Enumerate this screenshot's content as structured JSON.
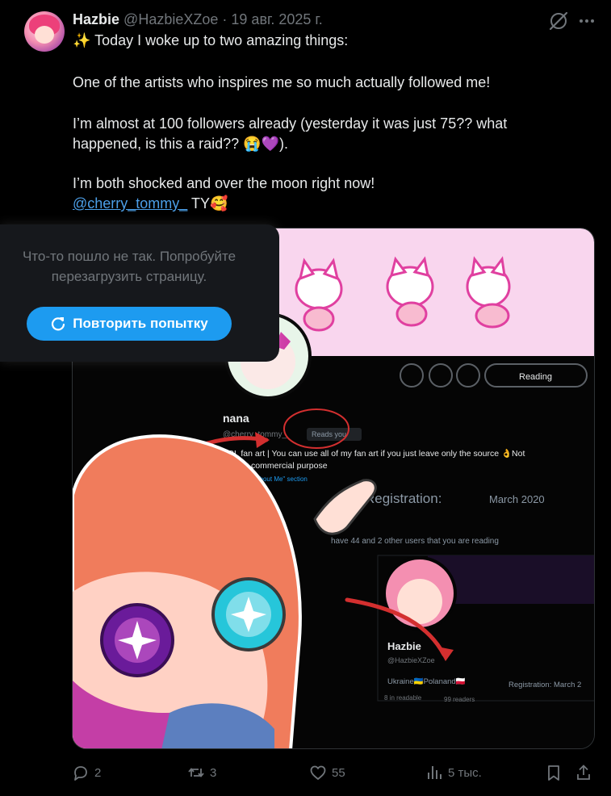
{
  "author": {
    "name": "Hazbie",
    "handle": "@HazbieXZoe",
    "separator": "·",
    "date": "19 авг. 2025 г."
  },
  "post": {
    "line1": "✨ Today I woke up to two amazing things:",
    "line2": "One of the artists who inspires me so much actually followed me!",
    "line3": "I’m almost at 100 followers already (yesterday it was just 75?? what",
    "line4": "happened, is this a raid?? 😭💜).",
    "line5": "I’m both shocked and over the moon right now!",
    "mention": "@cherry_tommy_",
    "after_mention": "TY🥰"
  },
  "media": {
    "profile1": {
      "name": "nana",
      "handle": "@cherry_tommy_",
      "reads_you": "Reads you",
      "bio": "LOL fan art | You can use all of my fan art if you just leave only the source 👌Not",
      "bio2": "for any commercial purpose",
      "about_link": "the \"About Me\" section",
      "registration_label": "Registration:",
      "registration_date": "March 2020",
      "reading_note": "have 44 and 2 other users that you are reading",
      "reading_button": "Reading"
    },
    "profile2": {
      "name": "Hazbie",
      "handle": "@HazbieXZoe",
      "location": "Ukraine🇺🇦Polanand🇵🇱",
      "registration": "Registration: March 2",
      "readable": "8 in readable",
      "readers": "99 readers"
    }
  },
  "error_toast": {
    "message": "Что-то пошло не так. Попробуйте\nперезагрузить страницу.",
    "retry_label": "Повторить попытку"
  },
  "actions": {
    "replies": "2",
    "reposts": "3",
    "likes": "55",
    "views": "5 тыс."
  },
  "colors": {
    "background": "#000000",
    "text": "#e7e9ea",
    "muted": "#71767b",
    "accent": "#1d9bf0",
    "mention": "#4c9fe8"
  },
  "icons": [
    "grok-icon",
    "more-icon",
    "retry-icon",
    "reply-icon",
    "repost-icon",
    "like-icon",
    "views-icon",
    "bookmark-icon",
    "share-icon"
  ]
}
